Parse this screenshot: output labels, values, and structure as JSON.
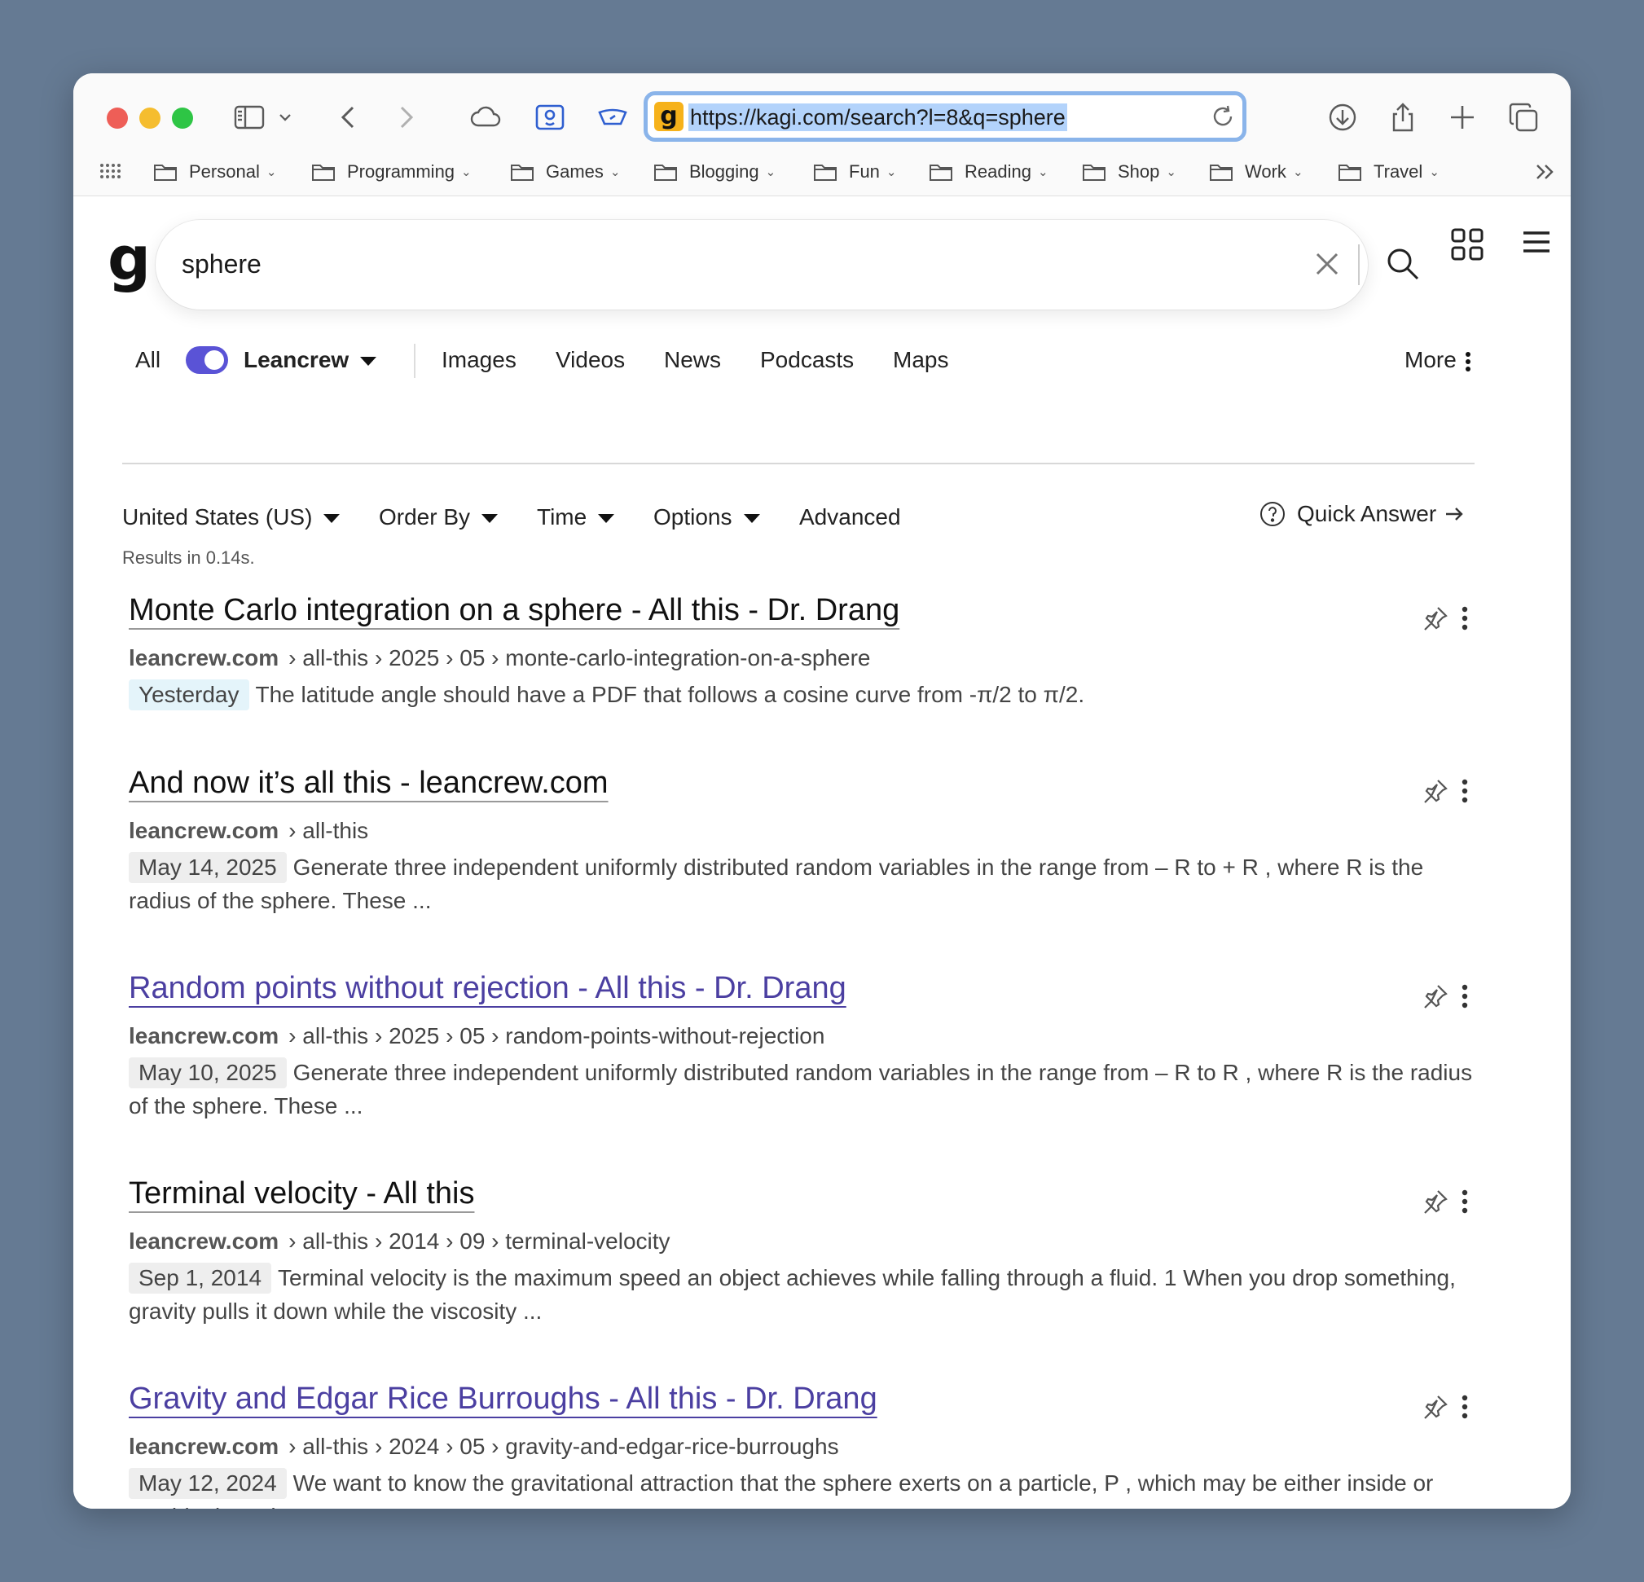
{
  "browser": {
    "url": "https://kagi.com/search?l=8&q=sphere",
    "favicon_letter": "g",
    "bookmarks": [
      "Personal",
      "Programming",
      "Games",
      "Blogging",
      "Fun",
      "Reading",
      "Shop",
      "Work",
      "Travel"
    ],
    "traffic_lights": {
      "close": "#ee5e57",
      "minimize": "#f5bd2f",
      "maximize": "#2ec545"
    },
    "accent": "#8ab4ea"
  },
  "search": {
    "logo": "g",
    "query": "sphere"
  },
  "tabs": {
    "all": "All",
    "lens": "Leancrew",
    "items": [
      "Images",
      "Videos",
      "News",
      "Podcasts",
      "Maps"
    ],
    "more": "More"
  },
  "filters": {
    "region": "United States (US)",
    "order_by": "Order By",
    "time": "Time",
    "options": "Options",
    "advanced": "Advanced",
    "quick_answer": "Quick Answer"
  },
  "results_time": "Results in 0.14s.",
  "results": [
    {
      "title": "Monte Carlo integration on a sphere - All this - Dr. Drang",
      "domain": "leancrew.com",
      "path": "› all-this › 2025 › 05 › monte-carlo-integration-on-a-sphere",
      "date": "Yesterday",
      "snippet": "The latitude angle should have a PDF that follows a cosine curve from -π/2 to π/2.",
      "visited": false
    },
    {
      "title": "And now it’s all this - leancrew.com",
      "domain": "leancrew.com",
      "path": "› all-this",
      "date": "May 14, 2025",
      "snippet": "Generate three independent uniformly distributed random variables in the range from – R to + R , where R is the radius of the sphere. These ...",
      "visited": false
    },
    {
      "title": "Random points without rejection - All this - Dr. Drang",
      "domain": "leancrew.com",
      "path": "› all-this › 2025 › 05 › random-points-without-rejection",
      "date": "May 10, 2025",
      "snippet": "Generate three independent uniformly distributed random variables in the range from – R to R , where R is the radius of the sphere. These ...",
      "visited": true
    },
    {
      "title": "Terminal velocity - All this",
      "domain": "leancrew.com",
      "path": "› all-this › 2014 › 09 › terminal-velocity",
      "date": "Sep 1, 2014",
      "snippet": "Terminal velocity is the maximum speed an object achieves while falling through a fluid. 1 When you drop something, gravity pulls it down while the viscosity ...",
      "visited": false
    },
    {
      "title": "Gravity and Edgar Rice Burroughs - All this - Dr. Drang",
      "domain": "leancrew.com",
      "path": "› all-this › 2024 › 05 › gravity-and-edgar-rice-burroughs",
      "date": "May 12, 2024",
      "snippet": "We want to know the gravitational attraction that the sphere exerts on a particle, P , which may be either inside or outside the sphere.",
      "visited": true
    }
  ]
}
